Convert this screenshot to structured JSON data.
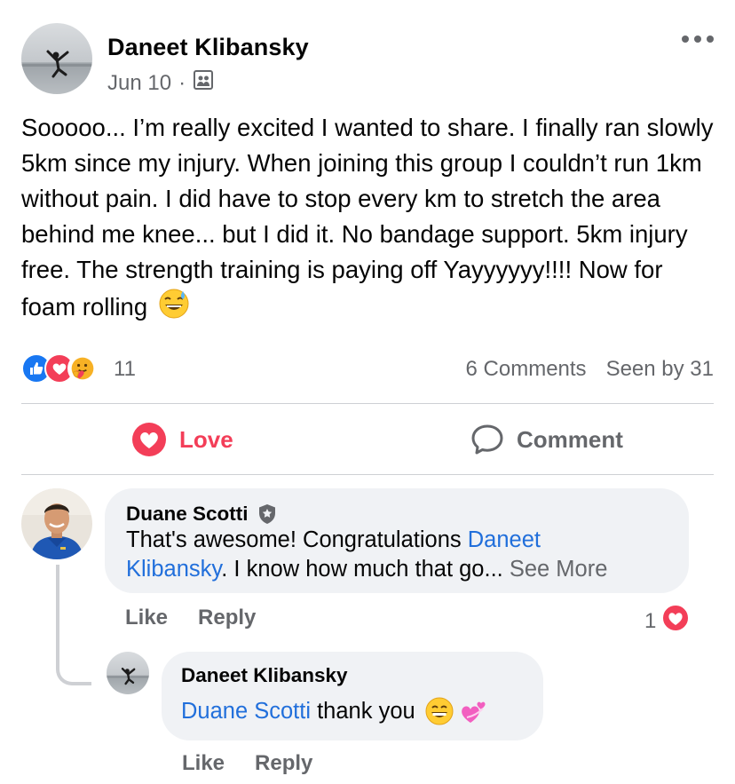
{
  "post": {
    "author": "Daneet Klibansky",
    "date": "Jun 10",
    "separator": "·",
    "privacy_icon": "group-members-icon",
    "more_icon": "more-options-icon",
    "text": "Sooooo... I’m really excited I wanted to share. I finally ran slowly 5km since my injury. When joining this group I couldn’t run 1km without pain. I did have to stop every km to stretch the area behind me knee... but I did it. No bandage support. 5km injury free. The strength training is paying off Yayyyyyy!!!! Now for foam rolling",
    "text_emoji": "grinning-sweat-emoji"
  },
  "reactions": {
    "icons": [
      "like-icon",
      "love-icon",
      "care-icon"
    ],
    "count": "11",
    "comments": "6 Comments",
    "seen": "Seen by 31"
  },
  "actions": {
    "love_label": "Love",
    "comment_label": "Comment"
  },
  "comments": [
    {
      "author": "Duane Scotti",
      "badge_icon": "admin-shield-icon",
      "text_line1_prefix": "That's awesome! Congratulations ",
      "mention_line1": "Daneet",
      "mention_line2": "Klibansky",
      "text_line2_suffix": ". I know how much that go...",
      "see_more": " See More",
      "like_label": "Like",
      "reply_label": "Reply",
      "reaction_count": "1",
      "reaction_icon": "love-icon"
    },
    {
      "author": "Daneet Klibansky",
      "mention": "Duane Scotti",
      "text": " thank you",
      "emojis": [
        "grinning-emoji",
        "revolving-hearts-emoji"
      ],
      "like_label": "Like",
      "reply_label": "Reply"
    }
  ],
  "colors": {
    "love": "#f33e58",
    "like": "#1877f2",
    "mention": "#216fdb",
    "muted": "#65676b",
    "bubble": "#f0f2f5"
  }
}
